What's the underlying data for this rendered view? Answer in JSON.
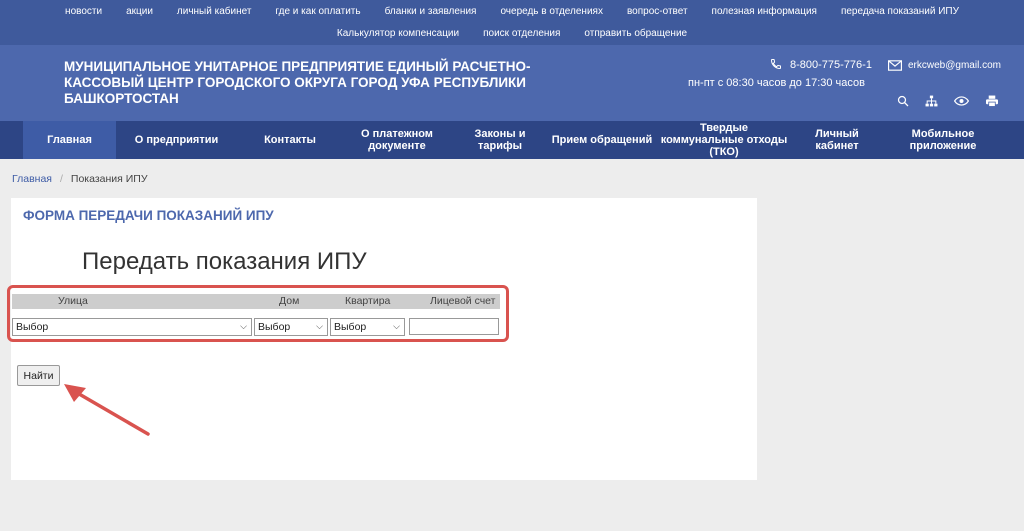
{
  "top_links": {
    "row1": [
      "новости",
      "акции",
      "личный кабинет",
      "где и как оплатить",
      "бланки и заявления",
      "очередь в отделениях",
      "вопрос-ответ",
      "полезная информация",
      "передача показаний ИПУ"
    ],
    "row2": [
      "Калькулятор компенсации",
      "поиск отделения",
      "отправить обращение"
    ]
  },
  "header": {
    "org_title": "МУНИЦИПАЛЬНОЕ УНИТАРНОЕ ПРЕДПРИЯТИЕ ЕДИНЫЙ РАСЧЕТНО-КАССОВЫЙ ЦЕНТР ГОРОДСКОГО ОКРУГА ГОРОД УФА РЕСПУБЛИКИ БАШКОРТОСТАН",
    "phone": "8-800-775-776-1",
    "hours": "пн-пт с 08:30 часов до 17:30 часов",
    "email": "erkcweb@gmail.com"
  },
  "nav": [
    "Главная",
    "О предприятии",
    "Контакты",
    "О платежном документе",
    "Законы и тарифы",
    "Прием обращений",
    "Твердые коммунальные отходы (ТКО)",
    "Личный кабинет",
    "Мобильное приложение"
  ],
  "breadcrumb": {
    "home": "Главная",
    "current": "Показания ИПУ"
  },
  "card": {
    "title": "ФОРМА ПЕРЕДАЧИ ПОКАЗАНИЙ ИПУ",
    "heading": "Передать показания ИПУ",
    "columns": {
      "street": "Улица",
      "house": "Дом",
      "apartment": "Квартира",
      "account": "Лицевой счет"
    },
    "street_value": "Выбор",
    "house_value": "Выбор",
    "apartment_value": "Выбор",
    "account_value": "",
    "search_button": "Найти"
  },
  "colors": {
    "topbar": "#3f5a9c",
    "header": "#4d68ad",
    "nav": "#2d4585",
    "highlight": "#d9534f"
  }
}
